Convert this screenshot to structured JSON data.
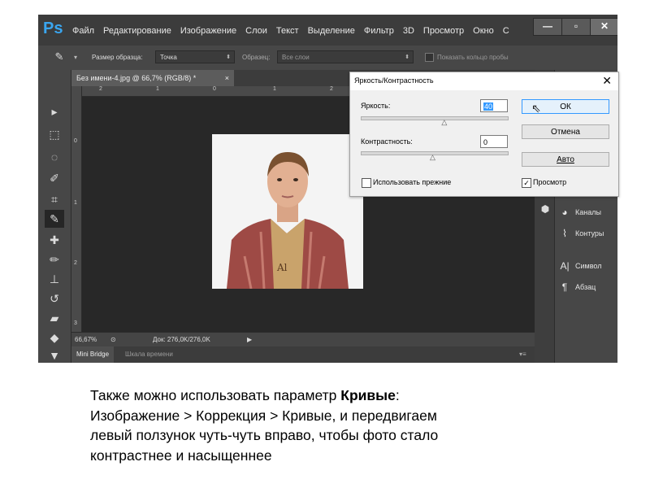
{
  "menubar": {
    "logo": "Ps",
    "items": [
      "Файл",
      "Редактирование",
      "Изображение",
      "Слои",
      "Текст",
      "Выделение",
      "Фильтр",
      "3D",
      "Просмотр",
      "Окно",
      "С"
    ],
    "minimize": "—",
    "maximize": "▫",
    "close": "✕"
  },
  "options": {
    "sample_size_label": "Размер образца:",
    "sample_size_value": "Точка",
    "sample_label": "Образец:",
    "sample_value": "Все слои",
    "show_ring_label": "Показать кольцо пробы"
  },
  "document": {
    "tab_title": "Без имени-4.jpg @ 66,7% (RGB/8) *",
    "tab_close": "×",
    "hruler_ticks": [
      "2",
      "1",
      "0",
      "1",
      "2"
    ],
    "vruler_ticks": [
      "0",
      "1",
      "2",
      "3"
    ],
    "zoom": "66,67%",
    "doc_size": "Док: 276,0K/276,0K"
  },
  "bottom_tabs": [
    "Mini Bridge",
    "Шкала времени"
  ],
  "right_panel": {
    "items": [
      {
        "label": "Каналы",
        "icon": "channels-icon"
      },
      {
        "label": "Контуры",
        "icon": "paths-icon"
      },
      {
        "label": "Символ",
        "icon": "character-icon"
      },
      {
        "label": "Абзац",
        "icon": "paragraph-icon"
      }
    ]
  },
  "dialog": {
    "title": "Яркость/Контрастность",
    "close": "✕",
    "brightness_label": "Яркость:",
    "brightness_value": "40",
    "contrast_label": "Контрастность:",
    "contrast_value": "0",
    "brightness_slider_pct": 58,
    "contrast_slider_pct": 50,
    "use_legacy_label": "Использовать прежние",
    "use_legacy_checked": false,
    "ok_label": "ОК",
    "cancel_label": "Отмена",
    "auto_label": "Авто",
    "preview_label": "Просмотр",
    "preview_checked": true
  },
  "caption": {
    "line1_prefix": "Также можно использовать  параметр ",
    "line1_bold": "Кривые",
    "line1_suffix": ":",
    "line2": "Изображение > Коррекция > Кривые, и передвигаем",
    "line3": "левый ползунок чуть-чуть вправо, чтобы фото стало",
    "line4": "контрастнее и насыщеннее"
  },
  "colors": {
    "ps_bg": "#535353",
    "menubar": "#3c3c3c",
    "accent": "#3aa6f0",
    "default_button_border": "#3399ff"
  }
}
